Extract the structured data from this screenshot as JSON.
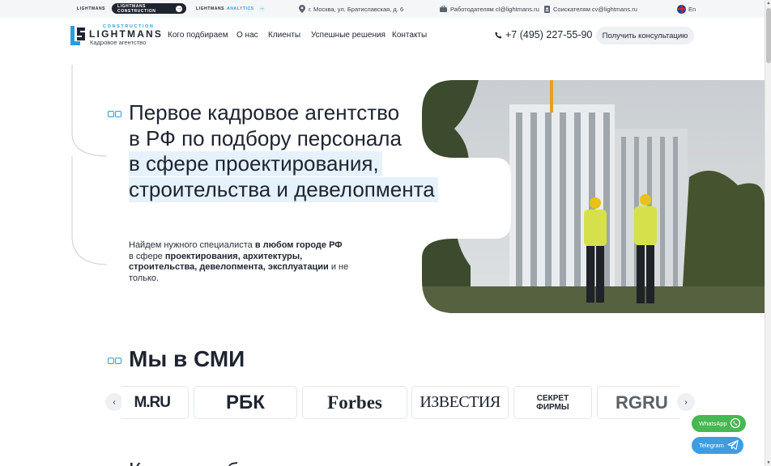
{
  "topbar": {
    "brands": [
      {
        "name": "LIGHTMANS",
        "sub": ""
      },
      {
        "name": "LIGHTMANS CONSTRUCTION",
        "sub": ""
      },
      {
        "name": "LIGHTMANS",
        "sub": "ANALYTICS"
      }
    ],
    "address": "г. Москва, ул. Братиславская, д. 6",
    "employers": "Работодателям cl@lightmans.ru",
    "candidates": "Соискателям cv@lightmans.ru",
    "language": "En"
  },
  "header": {
    "logo": {
      "top": "CONSTRUCTION",
      "name": "LIGHTMANS",
      "sub": "Кадровое агентство"
    },
    "nav": [
      "Кого подбираем",
      "О нас",
      "Клиенты",
      "Успешные решения",
      "Контакты"
    ],
    "phone": "+7 (495) 227-55-90",
    "cta": "Получить консультацию"
  },
  "hero": {
    "lines": [
      "Первое кадровое агентство",
      "в РФ по подбору персонала",
      "в сфере проектирования,",
      "строительства и девелопмента"
    ],
    "desc": {
      "p1": "Найдем нужного специалиста ",
      "b1": "в любом городе РФ",
      "p2": "в сфере ",
      "b2": "проектирования, архитектуры, строительства, девелопмента, эксплуатации",
      "p3": " и не только."
    }
  },
  "media": {
    "title": "Мы в СМИ",
    "logos": [
      "M.RU",
      "РБК",
      "Forbes",
      "ИЗВЕСТИЯ",
      "СЕКРЕТ ФИРМЫ",
      "RGRU"
    ],
    "prev": "‹",
    "next": "›"
  },
  "messengers": {
    "whatsapp": "WhatsApp",
    "telegram": "Telegram"
  },
  "next_section_peek": "Как мы работаем",
  "colors": {
    "accent": "#2a9de0",
    "dark": "#1e2430",
    "whatsapp": "#45b851",
    "telegram": "#3d9de3",
    "highlight": "#e6f2fb"
  }
}
